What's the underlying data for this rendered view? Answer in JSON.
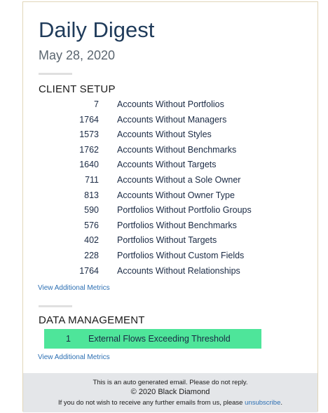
{
  "header": {
    "title": "Daily Digest",
    "date": "May 28, 2020"
  },
  "client_setup": {
    "title": "CLIENT SETUP",
    "metrics": [
      {
        "count": "7",
        "label": "Accounts Without Portfolios"
      },
      {
        "count": "1764",
        "label": "Accounts Without Managers"
      },
      {
        "count": "1573",
        "label": "Accounts Without Styles"
      },
      {
        "count": "1762",
        "label": "Accounts Without Benchmarks"
      },
      {
        "count": "1640",
        "label": "Accounts Without Targets"
      },
      {
        "count": "711",
        "label": "Accounts Without a Sole Owner"
      },
      {
        "count": "813",
        "label": "Accounts Without Owner Type"
      },
      {
        "count": "590",
        "label": "Portfolios Without Portfolio Groups"
      },
      {
        "count": "576",
        "label": "Portfolios Without Benchmarks"
      },
      {
        "count": "402",
        "label": "Portfolios Without Targets"
      },
      {
        "count": "228",
        "label": "Portfolios Without Custom Fields"
      },
      {
        "count": "1764",
        "label": "Accounts Without Relationships"
      }
    ],
    "link_label": "View Additional Metrics"
  },
  "data_management": {
    "title": "DATA MANAGEMENT",
    "metrics": [
      {
        "count": "1",
        "label": "External Flows Exceeding Threshold",
        "highlight_color": "#4ee59a"
      }
    ],
    "link_label": "View Additional Metrics"
  },
  "footer": {
    "auto_notice": "This is an auto generated email. Please do not reply.",
    "copyright": "© 2020 Black Diamond",
    "unsubscribe_prefix": "If you do not wish to receive any further emails from us, please ",
    "unsubscribe_link": "unsubscribe",
    "unsubscribe_suffix": "."
  },
  "colors": {
    "title": "#1f3b5a",
    "link": "#2c6fb3",
    "highlight": "#4ee59a",
    "footer_bg": "#e4e6e9"
  }
}
